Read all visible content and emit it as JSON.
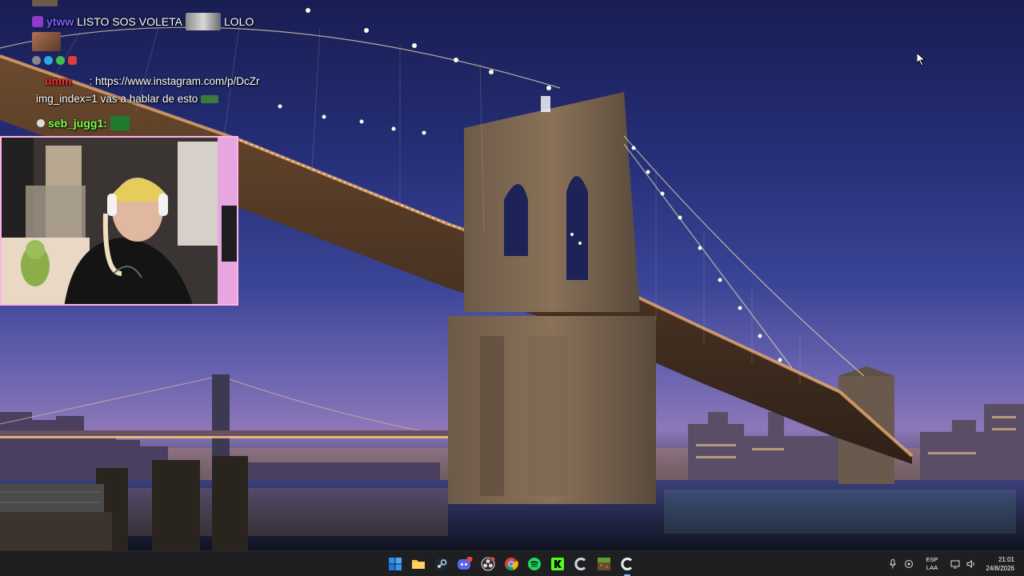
{
  "chat": {
    "line1": {
      "user": "ytww",
      "message": "LISTO SOS VOLETA",
      "emote_text": "LOLO"
    },
    "line2": {
      "user": "umm",
      "message": ": https://www.instagram.com/p/DcZr"
    },
    "line3": {
      "message": "img_index=1 vas a hablar de esto"
    },
    "line4": {
      "user": "seb_jugg1:"
    }
  },
  "colors": {
    "user_ytww": "#7b5cff",
    "user_umm": "#ff2a2a",
    "user_seb": "#7dff4a",
    "webcam_border": "#ffb3e6",
    "taskbar_bg": "#1f1f22"
  },
  "taskbar": {
    "apps": [
      {
        "name": "start-button",
        "icon": "windows-icon",
        "active": false
      },
      {
        "name": "file-explorer-button",
        "icon": "folder-icon",
        "active": false
      },
      {
        "name": "steam-button",
        "icon": "steam-icon",
        "active": false
      },
      {
        "name": "discord-button",
        "icon": "discord-icon",
        "active": false
      },
      {
        "name": "obs-button",
        "icon": "obs-icon",
        "active": false
      },
      {
        "name": "chrome-button",
        "icon": "chrome-icon",
        "active": false
      },
      {
        "name": "spotify-button",
        "icon": "spotify-icon",
        "active": false
      },
      {
        "name": "kick-button",
        "icon": "kick-icon",
        "active": false
      },
      {
        "name": "ccleaner-button",
        "icon": "ccleaner-icon",
        "active": false
      },
      {
        "name": "minecraft-button",
        "icon": "minecraft-icon",
        "active": false
      },
      {
        "name": "ccleaner-active-button",
        "icon": "ccleaner-icon",
        "active": true
      }
    ],
    "tray": {
      "lang_top": "ESP",
      "lang_bottom": "LAA",
      "time": "21:01",
      "date": "24/8/2026"
    }
  }
}
